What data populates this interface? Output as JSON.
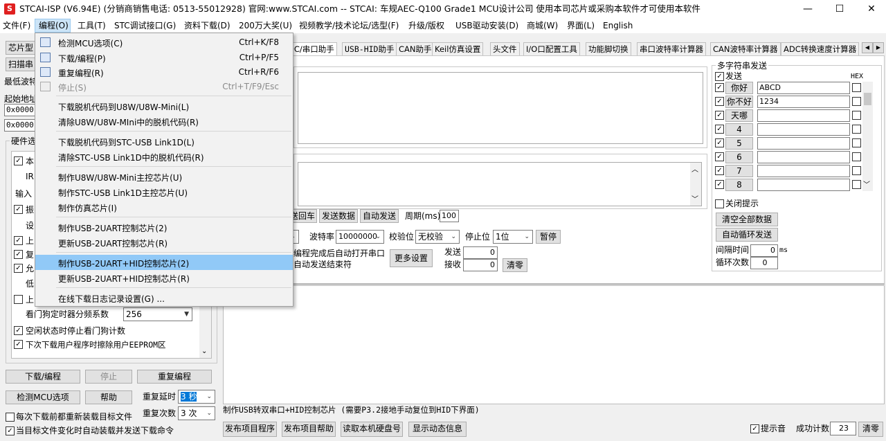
{
  "window": {
    "title": "STCAI-ISP (V6.94E) (分销商销售电话: 0513-55012928) 官网:www.STCAI.com  -- STCAI: 车规AEC-Q100 Grade1 MCU设计公司 使用本司芯片或采购本软件才可使用本软件",
    "minimize": "—",
    "maximize": "☐",
    "close": "✕"
  },
  "menu": {
    "items": [
      "文件(F)",
      "编程(O)",
      "工具(T)",
      "STC调试接口(G)",
      "资料下载(D)",
      "200万大奖(U)",
      "视频教学/技术论坛/选型(F)",
      "升级/版权",
      "USB驱动安装(D)",
      "商城(W)",
      "界面(L)",
      "English"
    ]
  },
  "dropdown": {
    "items": [
      {
        "label": "检测MCU选项(C)",
        "shortcut": "Ctrl+K/F8",
        "icon": "chip-icon"
      },
      {
        "label": "下载/编程(P)",
        "shortcut": "Ctrl+P/F5",
        "icon": "download-icon"
      },
      {
        "label": "重复编程(R)",
        "shortcut": "Ctrl+R/F6",
        "icon": "repeat-icon"
      },
      {
        "label": "停止(S)",
        "shortcut": "Ctrl+T/F9/Esc",
        "icon": "stop-icon"
      },
      {
        "label": "下载脱机代码到U8W/U8W-Mini(L)"
      },
      {
        "label": "清除U8W/U8W-MIni中的脱机代码(R)"
      },
      {
        "label": "下载脱机代码到STC-USB Link1D(L)"
      },
      {
        "label": "清除STC-USB Link1D中的脱机代码(R)"
      },
      {
        "label": "制作U8W/U8W-Mini主控芯片(U)"
      },
      {
        "label": "制作STC-USB Link1D主控芯片(U)"
      },
      {
        "label": "制作仿真芯片(I)"
      },
      {
        "label": "制作USB-2UART控制芯片(2)"
      },
      {
        "label": "更新USB-2UART控制芯片(R)"
      },
      {
        "label": "制作USB-2UART+HID控制芯片(2)"
      },
      {
        "label": "更新USB-2UART+HID控制芯片(R)"
      },
      {
        "label": "在线下载日志记录设置(G) ..."
      }
    ]
  },
  "left": {
    "chip_type_label": "芯片型",
    "scan_label": "扫描串",
    "min_baud_label": "最低波特",
    "start_addr_label": "起始地址",
    "addr1": "0x0000",
    "addr2": "0x0000",
    "hw_label": "硬件选",
    "opt_rows": [
      "本",
      "IR",
      "输入",
      "振",
      "设",
      "上",
      "复",
      "允",
      "低",
      "上"
    ],
    "wdt_label": "看门狗定时器分频系数",
    "wdt_value": "256",
    "idle_stop_wdt": "空闲状态时停止看门狗计数",
    "erase_eeprom": "下次下载用户程序时擦除用户EEPROM区",
    "btn_download": "下载/编程",
    "btn_stop": "停止",
    "btn_repeat": "重复编程",
    "btn_check": "检测MCU选项",
    "btn_help": "帮助",
    "repeat_delay_label": "重复延时",
    "repeat_delay_value": "3 秒",
    "repeat_count_label": "重复次数",
    "repeat_count_value": "3 次",
    "reload_each": "每次下载前都重新装载目标文件",
    "auto_reload": "当目标文件变化时自动装载并发送下载命令"
  },
  "tabs": [
    "DC/串口助手",
    "USB-HID助手",
    "CAN助手",
    "Keil仿真设置",
    "头文件",
    "I/O口配置工具",
    "功能脚切换",
    "串口波特率计算器",
    "CAN波特率计算器",
    "ADC转换速度计算器"
  ],
  "serial": {
    "send_return": "送回车",
    "send_data": "发送数据",
    "auto_send": "自动发送",
    "period_label": "周期(ms)",
    "period_value": "100",
    "baud_label": "波特率",
    "baud_value": "10000000",
    "parity_label": "校验位",
    "parity_value": "无校验",
    "stop_label": "停止位",
    "stop_value": "1位",
    "pause": "暂停",
    "auto_open": "编程完成后自动打开串口",
    "auto_end": "自动发送结束符",
    "more_settings": "更多设置",
    "sent_label": "发送",
    "sent_value": "0",
    "recv_label": "接收",
    "recv_value": "0",
    "clear": "清零"
  },
  "multi": {
    "title": "多字符串发送",
    "send_header": "发送",
    "hex_header": "HEX",
    "rows": [
      {
        "btn": "你好",
        "value": "ABCD"
      },
      {
        "btn": "你不好",
        "value": "1234"
      },
      {
        "btn": "天哪",
        "value": ""
      },
      {
        "btn": "4",
        "value": ""
      },
      {
        "btn": "5",
        "value": ""
      },
      {
        "btn": "6",
        "value": ""
      },
      {
        "btn": "7",
        "value": ""
      },
      {
        "btn": "8",
        "value": ""
      }
    ],
    "close_hint": "关闭提示",
    "clear_all": "清空全部数据",
    "auto_loop": "自动循环发送",
    "interval_label": "间隔时间",
    "interval_value": "0",
    "interval_unit": "ms",
    "loop_count_label": "循环次数",
    "loop_count_value": "0"
  },
  "status": {
    "message": "制作USB转双串口+HID控制芯片 (需要P3.2接地手动复位到HID下界面)"
  },
  "bottom": {
    "publish_program": "发布项目程序",
    "publish_help": "发布项目帮助",
    "read_disk": "读取本机硬盘号",
    "show_dynamic": "显示动态信息",
    "sound_hint": "提示音",
    "success_label": "成功计数",
    "success_value": "23",
    "clear": "清零"
  }
}
